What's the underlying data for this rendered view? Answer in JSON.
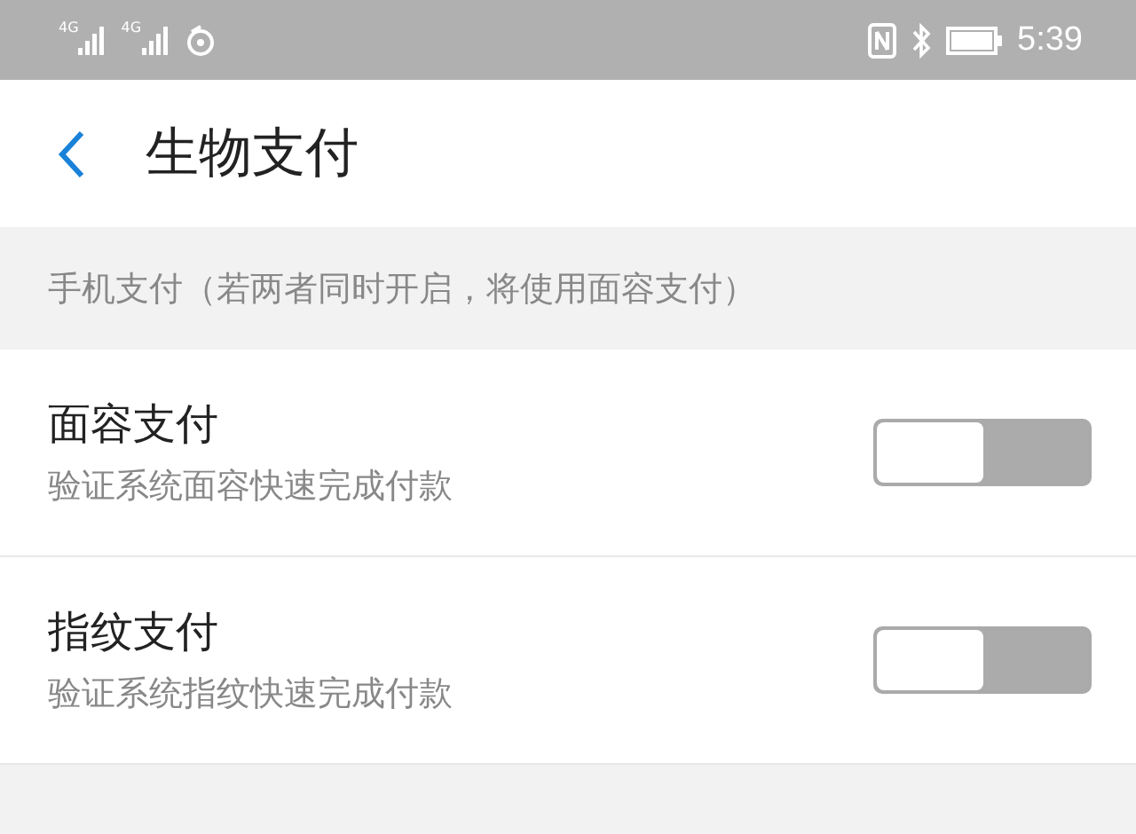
{
  "status_bar": {
    "networks": [
      "4G",
      "4G"
    ],
    "time": "5:39"
  },
  "header": {
    "title": "生物支付"
  },
  "section": {
    "title": "手机支付（若两者同时开启，将使用面容支付）"
  },
  "settings": [
    {
      "title": "面容支付",
      "subtitle": "验证系统面容快速完成付款",
      "on": false
    },
    {
      "title": "指纹支付",
      "subtitle": "验证系统指纹快速完成付款",
      "on": false
    }
  ]
}
